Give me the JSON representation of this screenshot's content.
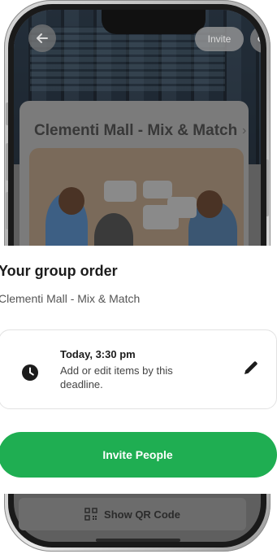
{
  "header": {
    "invite_label": "Invite"
  },
  "store_card": {
    "title": "Clementi Mall - Mix & Match"
  },
  "sheet": {
    "title": "Your group order",
    "subtitle": "Clementi Mall - Mix & Match",
    "deadline": {
      "time": "Today, 3:30 pm",
      "description": "Add or edit items by this deadline."
    },
    "primary_button": "Invite People"
  },
  "footer": {
    "qr_button": "Show QR Code"
  },
  "icons": {
    "back": "arrow-left-icon",
    "share": "share-icon",
    "clock": "clock-icon",
    "edit": "pencil-icon",
    "qr": "qr-code-icon",
    "chevron": "chevron-right-icon"
  },
  "colors": {
    "primary": "#1fae52",
    "sheet_bg": "#ffffff"
  }
}
